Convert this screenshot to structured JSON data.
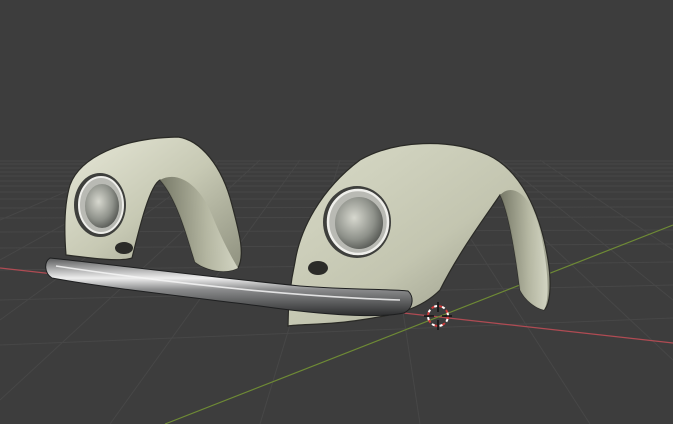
{
  "viewport": {
    "kind": "blender-3d-viewport",
    "background_color": "#3d3d3d",
    "grid_color": "#4a4a4a",
    "x_axis_color": "#c0525a",
    "y_axis_color": "#7a9a3a",
    "cursor_colors": [
      "#d23a3a",
      "#ffffff"
    ],
    "model_color": "#c9cbb7",
    "chrome_color": "#a9aaa8"
  },
  "objects": [
    {
      "name": "left-fender",
      "icon": "mesh-object"
    },
    {
      "name": "right-fender",
      "icon": "mesh-object"
    },
    {
      "name": "front-bumper",
      "icon": "mesh-object"
    },
    {
      "name": "3d-cursor",
      "icon": "3d-cursor-icon"
    }
  ]
}
